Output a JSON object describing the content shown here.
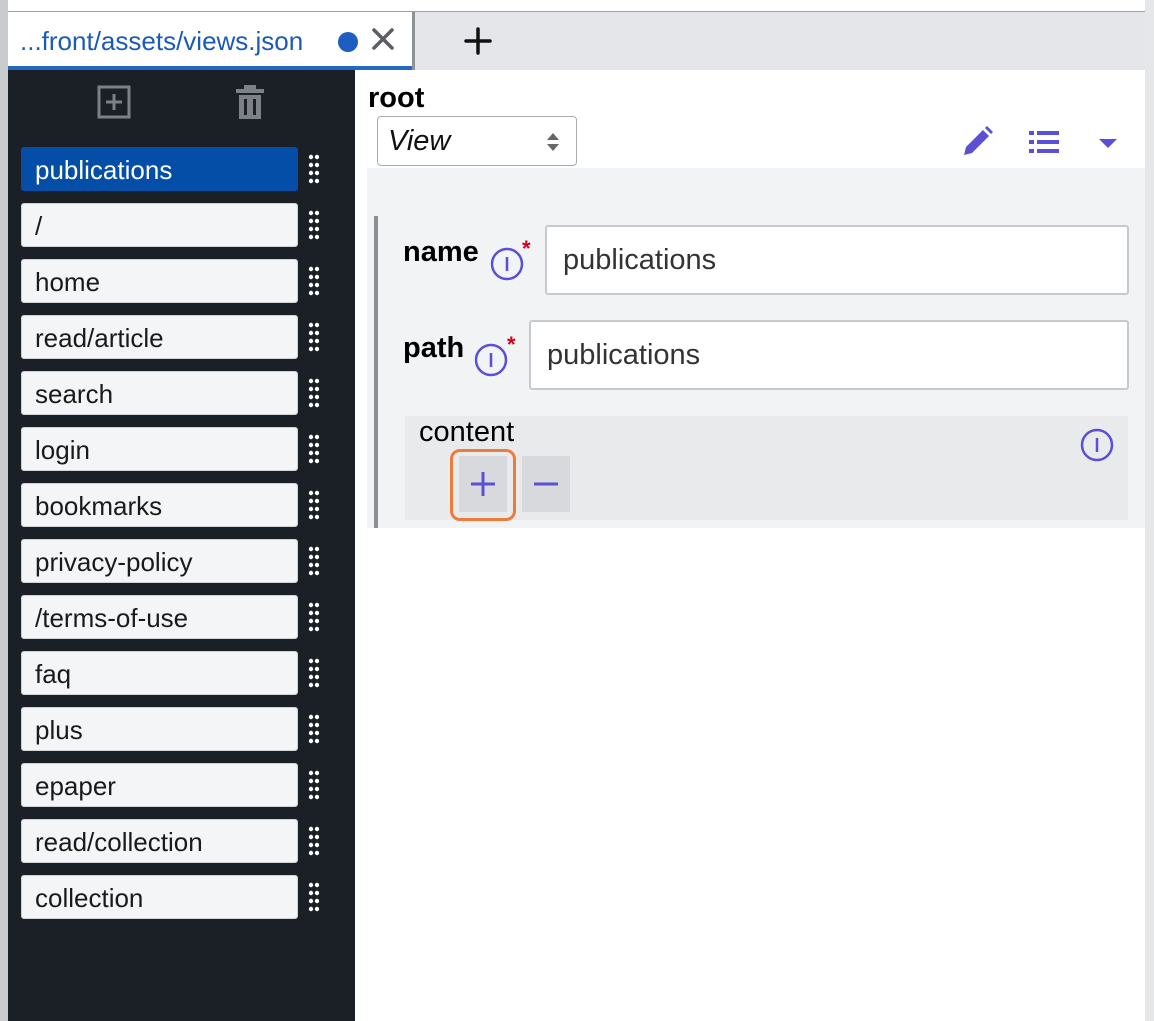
{
  "tab": {
    "title": "...front/assets/views.json",
    "unsaved_indicator": "dot",
    "close_icon": "close-icon",
    "add_icon": "plus-icon"
  },
  "sidebar": {
    "tools": [
      "add-item-icon",
      "trash-icon"
    ],
    "items": [
      {
        "label": "publications",
        "active": true
      },
      {
        "label": "/"
      },
      {
        "label": "home"
      },
      {
        "label": "read/article"
      },
      {
        "label": "search"
      },
      {
        "label": "login"
      },
      {
        "label": "bookmarks"
      },
      {
        "label": "privacy-policy"
      },
      {
        "label": "/terms-of-use"
      },
      {
        "label": "faq"
      },
      {
        "label": "plus"
      },
      {
        "label": "epaper"
      },
      {
        "label": "read/collection"
      },
      {
        "label": "collection"
      }
    ]
  },
  "main": {
    "root_title": "root",
    "type_select": {
      "value": "View"
    },
    "toolbar_icons": [
      "pencil-icon",
      "list-icon",
      "caret-down-icon"
    ],
    "fields": {
      "name": {
        "label": "name",
        "required": "*",
        "value": "publications"
      },
      "path": {
        "label": "path",
        "required": "*",
        "value": "publications"
      }
    },
    "content": {
      "label": "content",
      "add_label": "+",
      "remove_label": "−"
    }
  },
  "colors": {
    "accent": "#5b4fd6",
    "active_item": "#054ea8",
    "sidebar_bg": "#1b1f26",
    "focus_outline": "#ee7a3c",
    "required": "#d0021b"
  }
}
